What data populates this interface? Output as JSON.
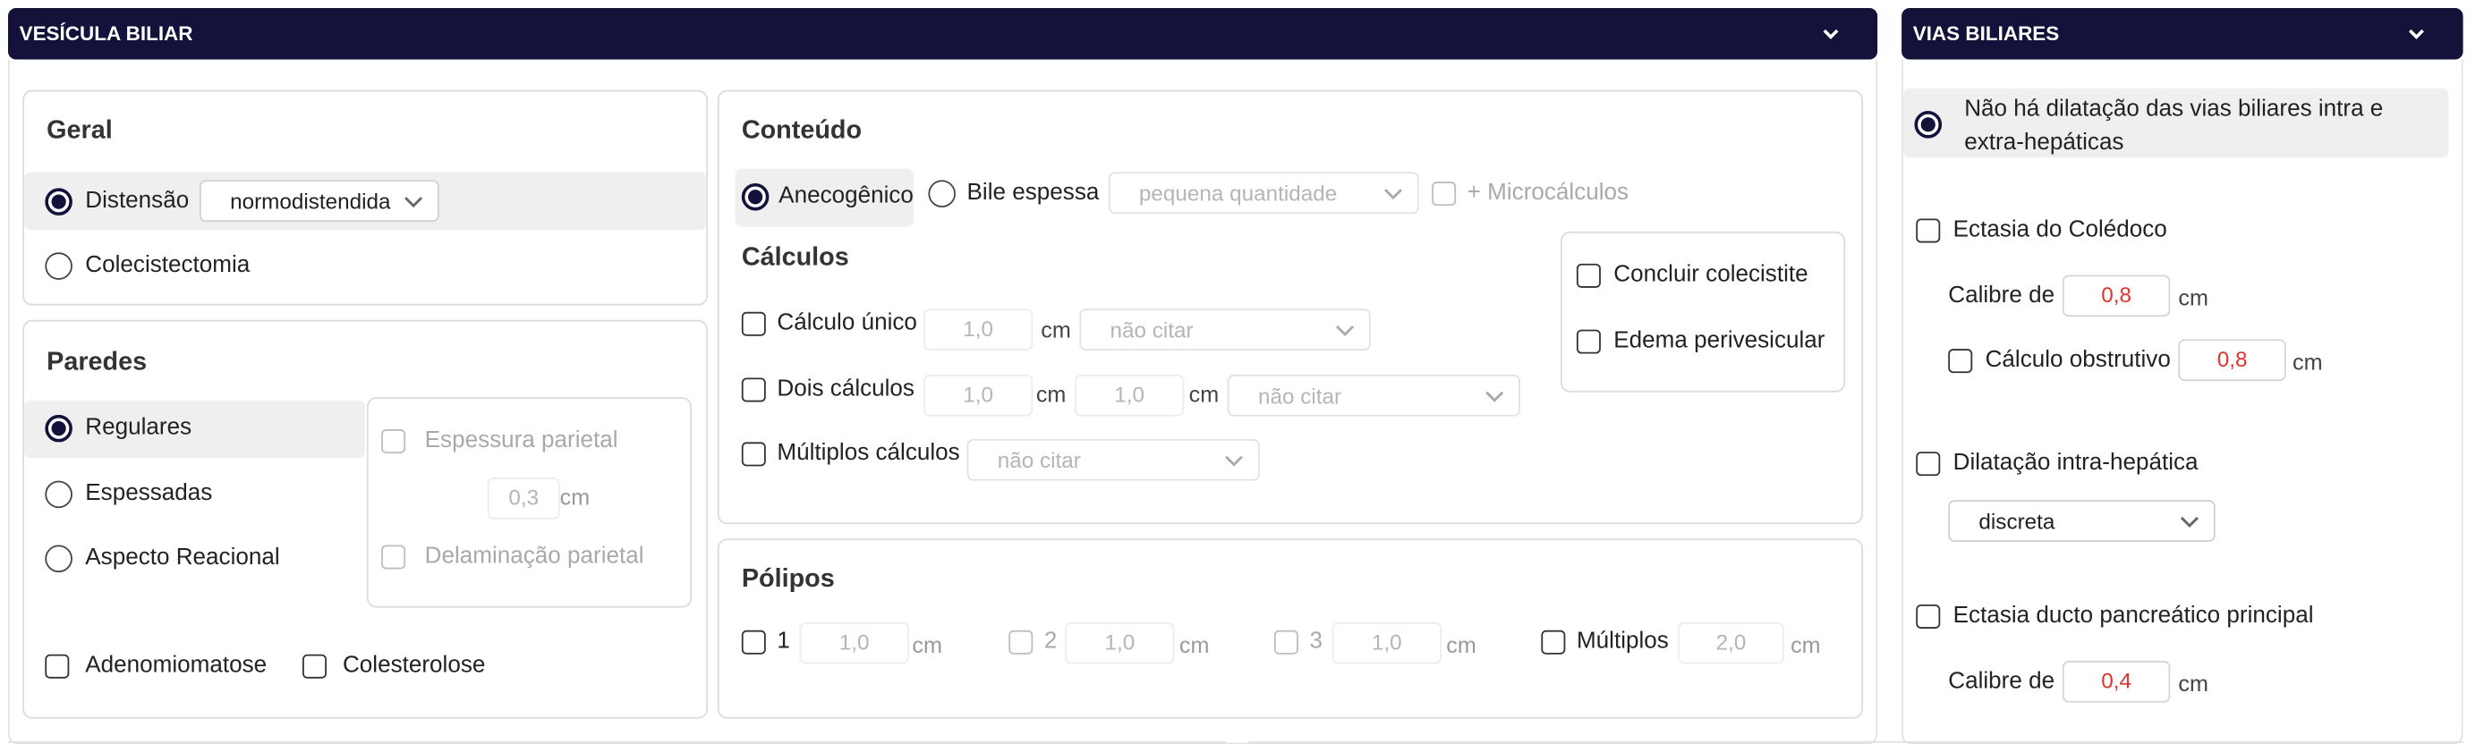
{
  "vesicula": {
    "header_title": "VESÍCULA BILIAR",
    "geral": {
      "title": "Geral",
      "distensao_label": "Distensão",
      "distensao_value": "normodistendida",
      "colecistectomia_label": "Colecistectomia"
    },
    "paredes": {
      "title": "Paredes",
      "regulares_label": "Regulares",
      "espessadas_label": "Espessadas",
      "aspecto_reacional_label": "Aspecto Reacional",
      "espessura_parietal_label": "Espessura parietal",
      "espessura_value": "0,3",
      "unit": "cm",
      "delaminacao_label": "Delaminação parietal",
      "adenomiomatose_label": "Adenomiomatose",
      "colesterolose_label": "Colesterolose"
    },
    "conteudo": {
      "title": "Conteúdo",
      "anecogenico_label": "Anecogênico",
      "bile_espessa_label": "Bile espessa",
      "bile_quantidade_value": "pequena quantidade",
      "microcalculos_label": "+ Microcálculos"
    },
    "calculos": {
      "title": "Cálculos",
      "unit": "cm",
      "calculo_unico_label": "Cálculo único",
      "calculo_unico_value": "1,0",
      "calculo_unico_select": "não citar",
      "dois_calculos_label": "Dois cálculos",
      "dois_calculos_value1": "1,0",
      "dois_calculos_value2": "1,0",
      "dois_calculos_select": "não citar",
      "multiplos_label": "Múltiplos cálculos",
      "multiplos_select": "não citar",
      "concluir_colecistite_label": "Concluir colecistite",
      "edema_perivesicular_label": "Edema perivesicular"
    },
    "polipos": {
      "title": "Pólipos",
      "unit": "cm",
      "items": [
        {
          "label": "1",
          "value": "1,0"
        },
        {
          "label": "2",
          "value": "1,0"
        },
        {
          "label": "3",
          "value": "1,0"
        },
        {
          "label": "Múltiplos",
          "value": "2,0"
        }
      ]
    }
  },
  "vias": {
    "header_title": "VIAS BILIARES",
    "nao_dilatacao_label": "Não há dilatação das vias biliares intra e extra-hepáticas",
    "ectasia_coledoco_label": "Ectasia do Colédoco",
    "calibre_label": "Calibre de",
    "calibre_coledoco_value": "0,8",
    "unit": "cm",
    "calculo_obstrutivo_label": "Cálculo obstrutivo",
    "calculo_obstrutivo_value": "0,8",
    "dilatacao_intra_label": "Dilatação intra-hepática",
    "dilatacao_intra_select": "discreta",
    "ectasia_ducto_label": "Ectasia ducto pancreático principal",
    "calibre_ducto_value": "0,4"
  },
  "colors": {
    "header_bg": "#12123a",
    "accent_red": "#e0332d",
    "highlight_bg": "#efefef"
  }
}
